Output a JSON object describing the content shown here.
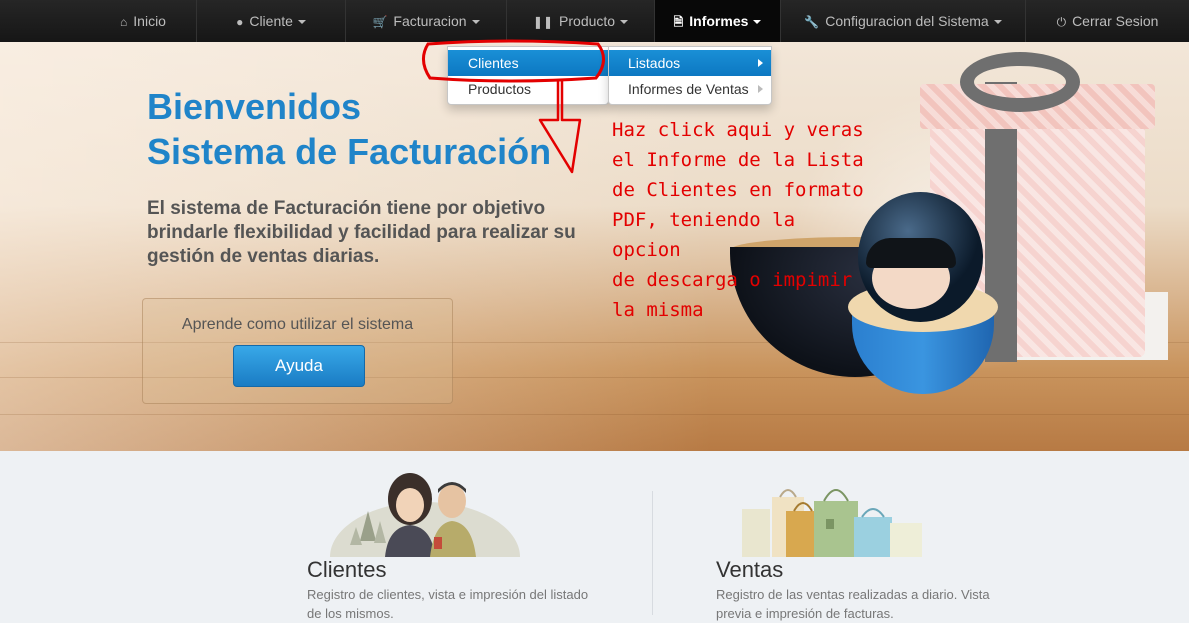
{
  "navbar": {
    "items": [
      {
        "label": "Inicio",
        "icon": "home-icon"
      },
      {
        "label": "Cliente",
        "icon": "user-icon"
      },
      {
        "label": "Facturacion",
        "icon": "cart-icon"
      },
      {
        "label": "Producto",
        "icon": "barcode-icon"
      },
      {
        "label": "Informes",
        "icon": "file-icon"
      },
      {
        "label": "Configuracion del Sistema",
        "icon": "wrench-icon"
      },
      {
        "label": "Cerrar Sesion",
        "icon": "power-icon"
      }
    ],
    "active": "Informes"
  },
  "dropdown": {
    "main": [
      "Clientes",
      "Productos"
    ],
    "sub": [
      "Listados",
      "Informes de Ventas"
    ]
  },
  "hero": {
    "title_line1": "Bienvenidos",
    "title_line2": "Sistema de Facturación",
    "lead": "El sistema de Facturación tiene por objetivo brindarle flexibilidad y facilidad para realizar su gestión de ventas diarias.",
    "help_text": "Aprende como utilizar el sistema",
    "help_button": "Ayuda"
  },
  "annotation": {
    "lines": [
      "Haz click aqui y veras",
      "el Informe de la Lista",
      "de Clientes en formato",
      "PDF, teniendo la opcion",
      "de descarga o impimir",
      "la misma"
    ]
  },
  "cards": [
    {
      "title": "Clientes",
      "text": "Registro de clientes, vista e impresión del listado de los mismos."
    },
    {
      "title": "Ventas",
      "text": "Registro de las ventas realizadas a diario. Vista previa e impresión de facturas."
    }
  ],
  "colors": {
    "accent": "#1f84c9",
    "navbar": "#222222",
    "annotation": "#e30000",
    "button": "#1a8fd6"
  }
}
